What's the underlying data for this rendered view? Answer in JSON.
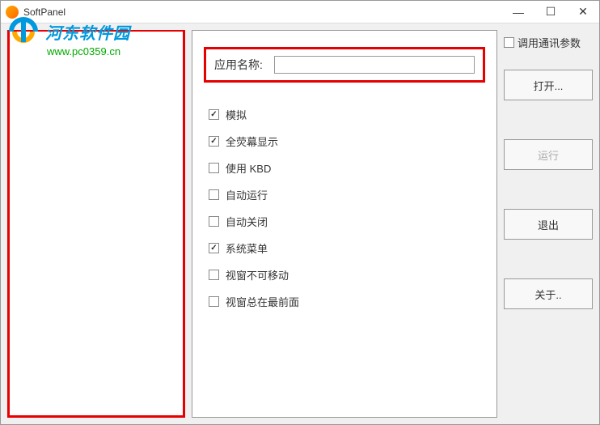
{
  "window": {
    "title": "SoftPanel"
  },
  "watermark": {
    "site_name": "河东软件园",
    "url": "www.pc0359.cn"
  },
  "center": {
    "app_name_label": "应用名称:",
    "app_name_value": "",
    "checkboxes": [
      {
        "label": "模拟",
        "checked": true
      },
      {
        "label": "全荧幕显示",
        "checked": true
      },
      {
        "label": "使用 KBD",
        "checked": false
      },
      {
        "label": "自动运行",
        "checked": false
      },
      {
        "label": "自动关闭",
        "checked": false
      },
      {
        "label": "系统菜单",
        "checked": true
      },
      {
        "label": "视窗不可移动",
        "checked": false
      },
      {
        "label": "视窗总在最前面",
        "checked": false
      }
    ]
  },
  "right": {
    "comm_params_label": "调用通讯参数",
    "comm_params_checked": false,
    "buttons": {
      "open": "打开...",
      "run": "运行",
      "exit": "退出",
      "about": "关于.."
    }
  }
}
